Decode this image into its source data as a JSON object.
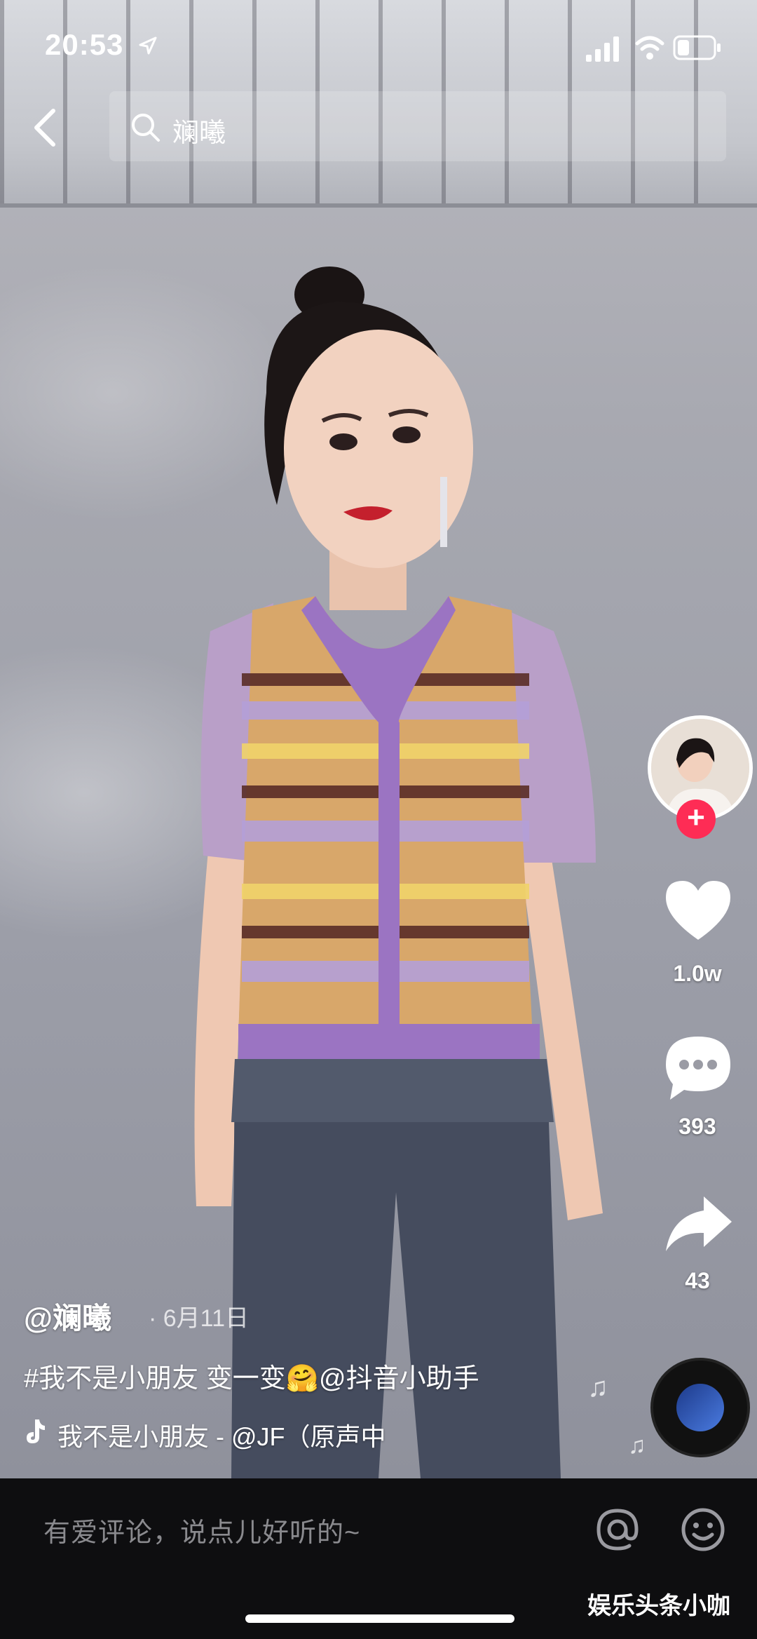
{
  "status_bar": {
    "time": "20:53"
  },
  "search": {
    "query": "斓曦"
  },
  "side_actions": {
    "likes": "1.0w",
    "comments": "393",
    "shares": "43",
    "follow": "+"
  },
  "post": {
    "author": "@斓曦",
    "date": "· 6月11日",
    "caption": "#我不是小朋友 变一变🤗@抖音小助手",
    "music": "我不是小朋友 - @JF（原声中"
  },
  "comment_bar": {
    "placeholder": "有爱评论，说点儿好听的~"
  },
  "watermark": "娱乐头条小咖",
  "colors": {
    "follow": "#fe2c55",
    "bottom_bar": "#0e0e10"
  }
}
